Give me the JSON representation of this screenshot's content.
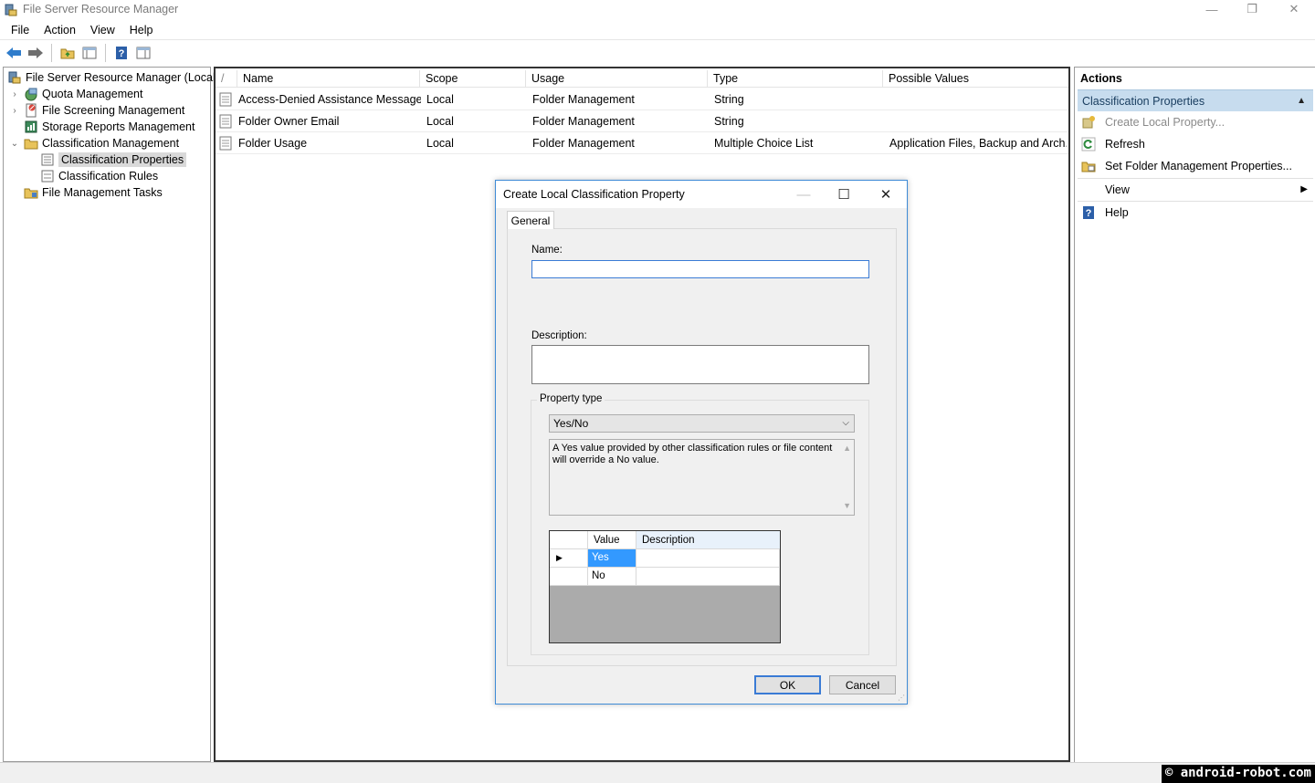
{
  "window": {
    "title": "File Server Resource Manager"
  },
  "menu": {
    "items": [
      "File",
      "Action",
      "View",
      "Help"
    ]
  },
  "tree": {
    "root": "File Server Resource Manager (Local)",
    "items": [
      {
        "label": "Quota Management"
      },
      {
        "label": "File Screening Management"
      },
      {
        "label": "Storage Reports Management"
      },
      {
        "label": "Classification Management"
      },
      {
        "label": "Classification Properties"
      },
      {
        "label": "Classification Rules"
      },
      {
        "label": "File Management Tasks"
      }
    ]
  },
  "list": {
    "columns": [
      "/",
      "Name",
      "Scope",
      "Usage",
      "Type",
      "Possible Values"
    ],
    "rows": [
      {
        "name": "Access-Denied Assistance Message",
        "scope": "Local",
        "usage": "Folder Management",
        "type": "String",
        "values": ""
      },
      {
        "name": "Folder Owner Email",
        "scope": "Local",
        "usage": "Folder Management",
        "type": "String",
        "values": ""
      },
      {
        "name": "Folder Usage",
        "scope": "Local",
        "usage": "Folder Management",
        "type": "Multiple Choice List",
        "values": "Application Files, Backup and Arch..."
      }
    ]
  },
  "actions": {
    "title": "Actions",
    "section": "Classification Properties",
    "items": [
      "Create Local Property...",
      "Refresh",
      "Set Folder Management Properties...",
      "View",
      "Help"
    ]
  },
  "dialog": {
    "title": "Create Local Classification Property",
    "tab": "General",
    "name_label": "Name:",
    "name_value": "",
    "description_label": "Description:",
    "description_value": "",
    "property_type_label": "Property type",
    "property_type_value": "Yes/No",
    "type_description": "A Yes value provided by other classification rules or file content will override a No value.",
    "grid": {
      "columns": [
        "Value",
        "Description"
      ],
      "rows": [
        {
          "value": "Yes",
          "description": ""
        },
        {
          "value": "No",
          "description": ""
        }
      ]
    },
    "ok_label": "OK",
    "cancel_label": "Cancel"
  },
  "watermark": "© android-robot.com",
  "colors": {
    "accent": "#3399ff",
    "section_bg": "#c7dcee",
    "dialog_border": "#3f8bd6"
  }
}
